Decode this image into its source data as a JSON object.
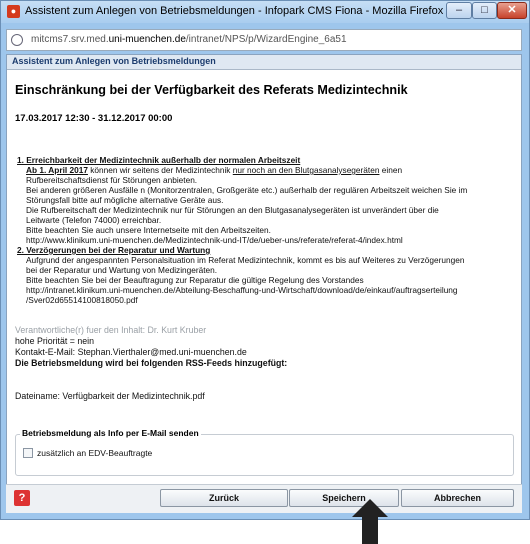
{
  "window": {
    "title": "Assistent zum Anlegen von Betriebsmeldungen - Infopark CMS Fiona - Mozilla Firefox",
    "min": "–",
    "max": "□",
    "close": "✕"
  },
  "urlbar": {
    "prefix": "mitcms7.srv.med.",
    "domain": "uni-muenchen.de",
    "path": "/intranet/NPS/p/WizardEngine_6a51"
  },
  "page_header": "Assistent zum Anlegen von Betriebsmeldungen",
  "heading": "Einschränkung bei der Verfügbarkeit des Referats Medizintechnik",
  "date_range": "17.03.2017 12:30 - 31.12.2017 00:00",
  "section1": {
    "title": "1. Erreichbarkeit der Medizintechnik außerhalb der normalen Arbeitszeit",
    "line1_a": "Ab 1. April 2017",
    "line1_b": " können wir seitens der Medizintechnik ",
    "line1_c": "nur noch an den Blutgasanalysegeräten",
    "line1_d": " einen",
    "lines": [
      "Rufbereitschaftsdienst für Störungen anbieten.",
      "Bei anderen größeren Ausfälle n (Monitorzentralen, Großgeräte etc.) außerhalb der regulären Arbeitszeit weichen Sie im",
      "Störungsfall bitte auf mögliche alternative Geräte aus.",
      "Die Rufbereitschaft der Medizintechnik nur für Störungen an den Blutgasanalysegeräten ist unverändert über die",
      "Leitwarte (Telefon 74000) erreichbar.",
      "Bitte beachten Sie auch unsere Internetseite mit den Arbeitszeiten.",
      "http://www.klinikum.uni-muenchen.de/Medizintechnik-und-IT/de/ueber-uns/referate/referat-4/index.html"
    ]
  },
  "section2": {
    "title": "2. Verzögerungen bei der Reparatur und Wartung",
    "lines": [
      "Aufgrund der angespannten Personalsituation im Referat Medizintechnik, kommt es bis auf Weiteres zu Verzögerungen",
      "bei der Reparatur und Wartung von Medizingeräten.",
      "Bitte beachten Sie bei der Beauftragung zur Reparatur die gültige Regelung des Vorstandes",
      "http://intranet.klinikum.uni-muenchen.de/Abteilung-Beschaffung-und-Wirtschaft/download/de/einkauf/auftragserteilung",
      "/Sver02d65514100818050.pdf"
    ]
  },
  "meta": {
    "responsible": "Verantwortliche(r) fuer den Inhalt: Dr. Kurt Kruber",
    "priority": "hohe Priorität = nein",
    "contact": "Kontakt-E-Mail: Stephan.Vierthaler@med.uni-muenchen.de",
    "rss": "Die Betriebsmeldung wird bei folgenden RSS-Feeds hinzugefügt:",
    "filename": "Dateiname: Verfügbarkeit der Medizintechnik.pdf"
  },
  "email_group": {
    "legend": "Betriebsmeldung als Info per E-Mail senden",
    "option": "zusätzlich an EDV-Beauftragte",
    "checked": false
  },
  "footer": {
    "help": "?",
    "back": "Zurück",
    "save": "Speichern",
    "cancel": "Abbrechen"
  }
}
